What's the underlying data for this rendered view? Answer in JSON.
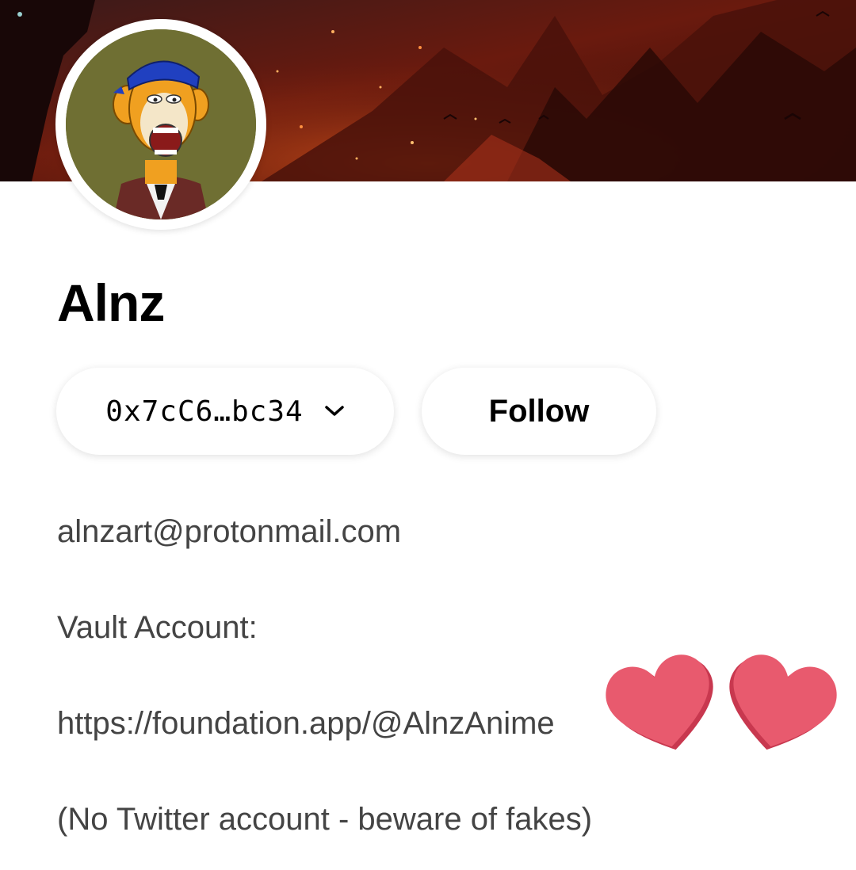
{
  "profile": {
    "display_name": "Alnz",
    "wallet_address": "0x7cC6…bc34",
    "follow_label": "Follow",
    "bio": {
      "email": "alnzart@protonmail.com",
      "vault_label": "Vault Account:",
      "vault_url": "https://foundation.app/@AlnzAnime",
      "note": "(No Twitter account - beware of fakes)"
    }
  },
  "icons": {
    "wallet_dropdown": "chevron-down-icon",
    "decoration": "heart-icon"
  },
  "colors": {
    "heart": "#e85a6e",
    "heart_shadow": "#c8384f",
    "avatar_bg": "#6f6f33",
    "banner_dark": "#2a0c08",
    "banner_red": "#8a1e10",
    "bio_text": "#444444"
  }
}
